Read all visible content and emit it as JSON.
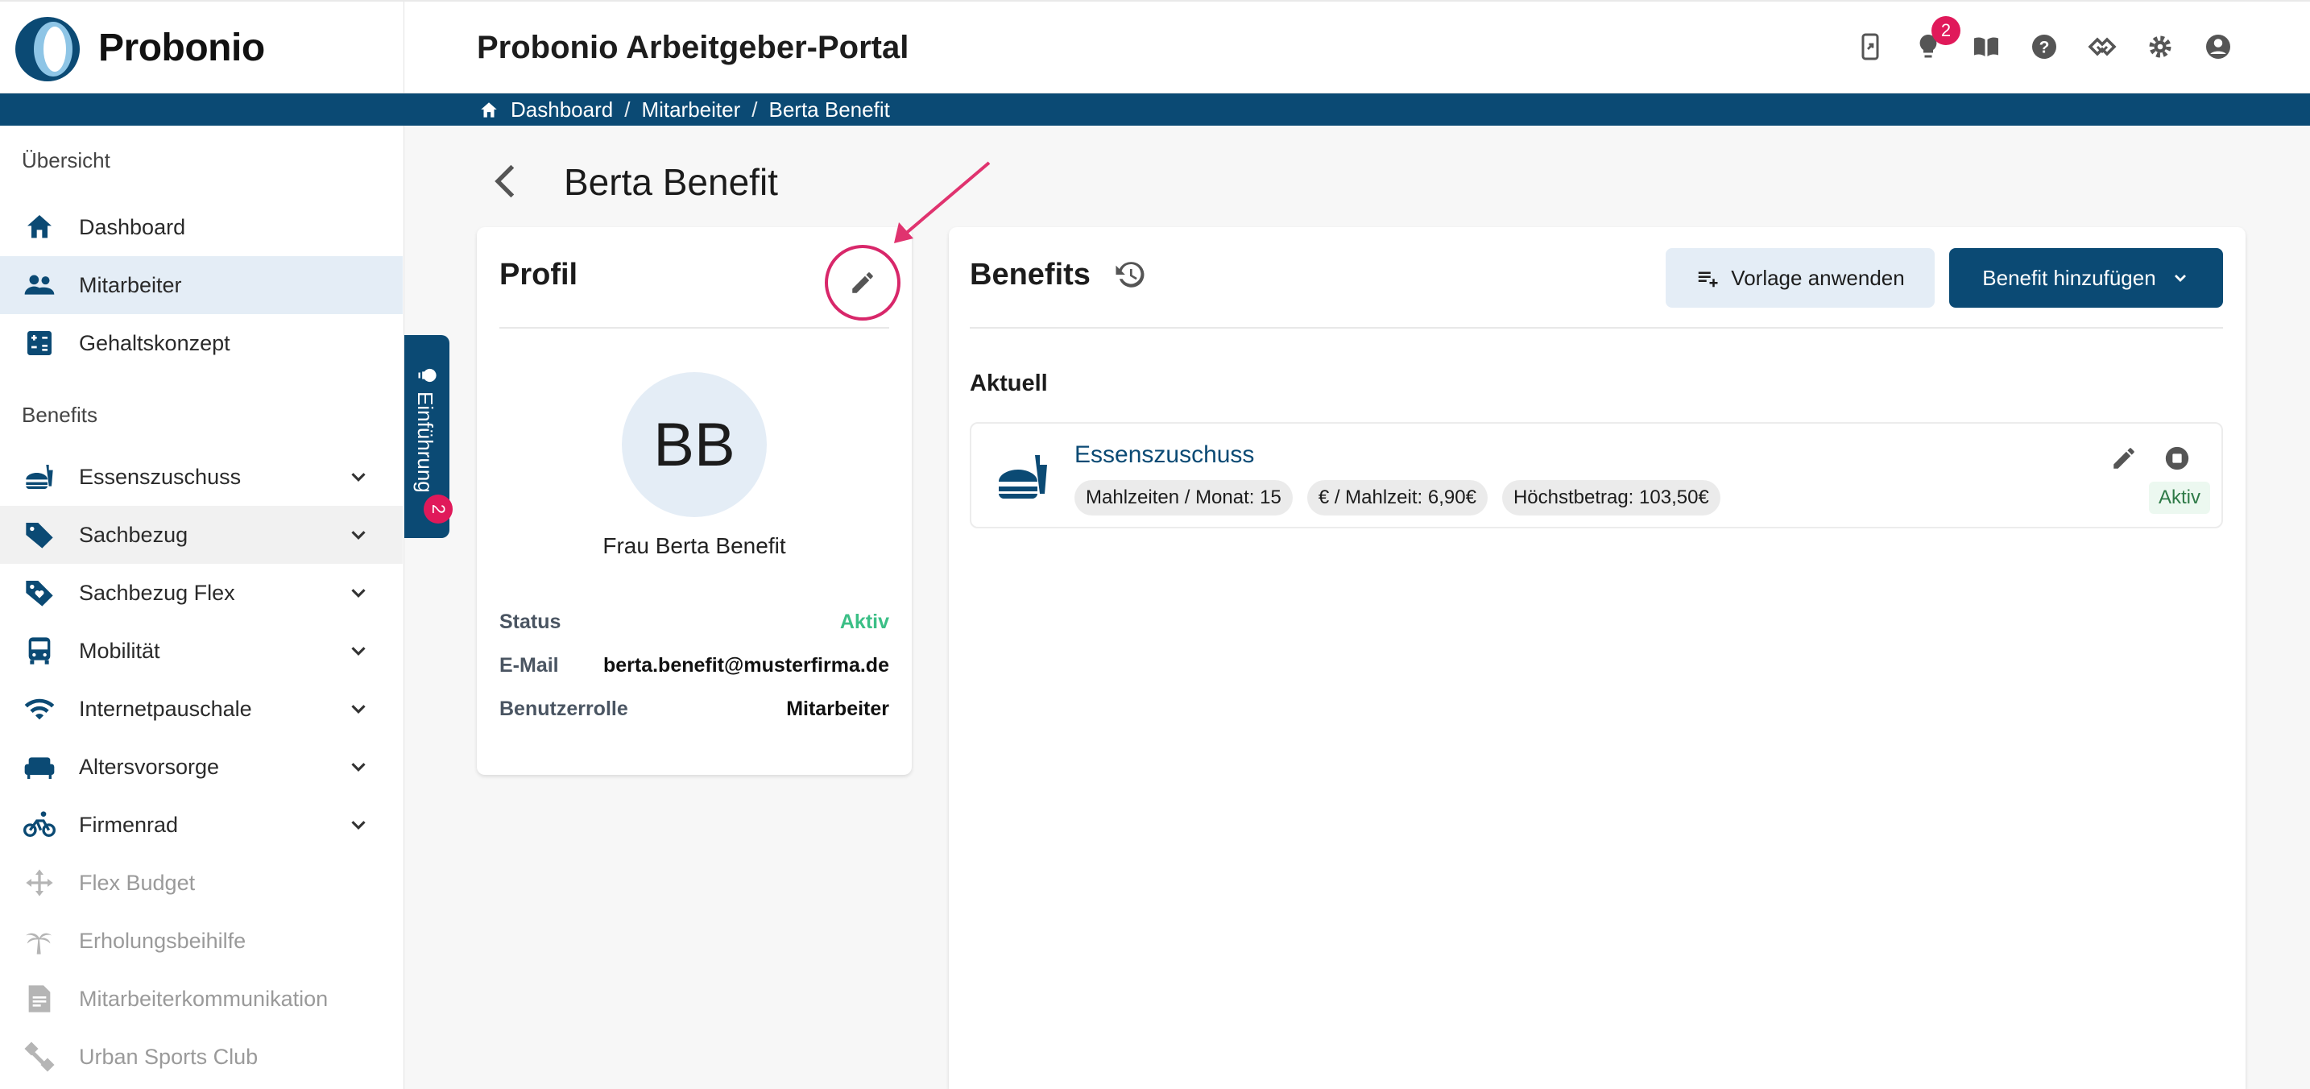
{
  "brand": {
    "name": "Probonio",
    "portal_title": "Probonio Arbeitgeber-Portal",
    "primary_color": "#0b4a74",
    "accent_color": "#e0195a"
  },
  "header": {
    "icons": [
      "phone-app-icon",
      "lightbulb-icon",
      "book-icon",
      "help-icon",
      "handshake-icon",
      "gear-icon",
      "account-icon"
    ],
    "notification_count": "2"
  },
  "breadcrumb": [
    "Dashboard",
    "Mitarbeiter",
    "Berta Benefit"
  ],
  "sidebar": {
    "section_overview": "Übersicht",
    "overview_items": [
      {
        "label": "Dashboard",
        "icon": "home-icon"
      },
      {
        "label": "Mitarbeiter",
        "icon": "people-icon"
      },
      {
        "label": "Gehaltskonzept",
        "icon": "calculator-icon"
      }
    ],
    "section_benefits": "Benefits",
    "benefit_items": [
      {
        "label": "Essenszuschuss",
        "icon": "food-icon"
      },
      {
        "label": "Sachbezug",
        "icon": "tag-icon"
      },
      {
        "label": "Sachbezug Flex",
        "icon": "tag-heart-icon"
      },
      {
        "label": "Mobilität",
        "icon": "bus-icon"
      },
      {
        "label": "Internetpauschale",
        "icon": "wifi-icon"
      },
      {
        "label": "Altersvorsorge",
        "icon": "sofa-icon"
      },
      {
        "label": "Firmenrad",
        "icon": "bike-icon"
      },
      {
        "label": "Flex Budget",
        "icon": "arrows-icon"
      },
      {
        "label": "Erholungsbeihilfe",
        "icon": "palm-icon"
      },
      {
        "label": "Mitarbeiterkommunikation",
        "icon": "document-icon"
      },
      {
        "label": "Urban Sports Club",
        "icon": "dumbbell-icon"
      }
    ],
    "intro_tab": "Einführung",
    "intro_badge": "2"
  },
  "page": {
    "title": "Berta Benefit"
  },
  "profile": {
    "title": "Profil",
    "initials": "BB",
    "full_name": "Frau Berta Benefit",
    "rows": [
      {
        "key": "Status",
        "value": "Aktiv"
      },
      {
        "key": "E-Mail",
        "value": "berta.benefit@musterfirma.de"
      },
      {
        "key": "Benutzerrolle",
        "value": "Mitarbeiter"
      }
    ]
  },
  "benefits": {
    "title": "Benefits",
    "apply_template_label": "Vorlage anwenden",
    "add_benefit_label": "Benefit hinzufügen",
    "current_label": "Aktuell",
    "items": [
      {
        "name": "Essenszuschuss",
        "chips": [
          "Mahlzeiten / Monat: 15",
          "€ / Mahlzeit: 6,90€",
          "Höchstbetrag: 103,50€"
        ],
        "status": "Aktiv"
      }
    ]
  }
}
